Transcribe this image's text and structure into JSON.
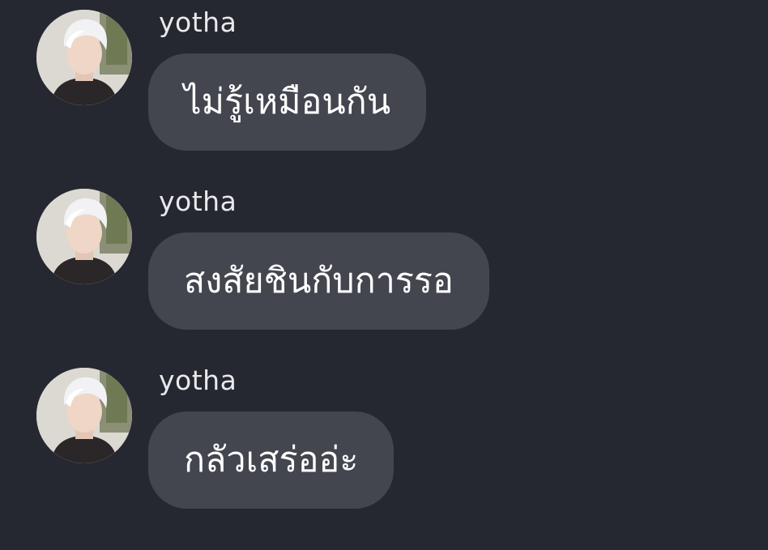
{
  "colors": {
    "background": "#252830",
    "bubble": "#43464f",
    "sender_text": "#e9e9ec",
    "message_text": "#ffffff"
  },
  "messages": [
    {
      "sender": "yotha",
      "text": "ไม่รู้เหมือนกัน",
      "avatar_icon": "user-avatar-icon"
    },
    {
      "sender": "yotha",
      "text": "สงสัยชินกับการรอ",
      "avatar_icon": "user-avatar-icon"
    },
    {
      "sender": "yotha",
      "text": "กลัวเสร่ออ่ะ",
      "avatar_icon": "user-avatar-icon"
    }
  ]
}
